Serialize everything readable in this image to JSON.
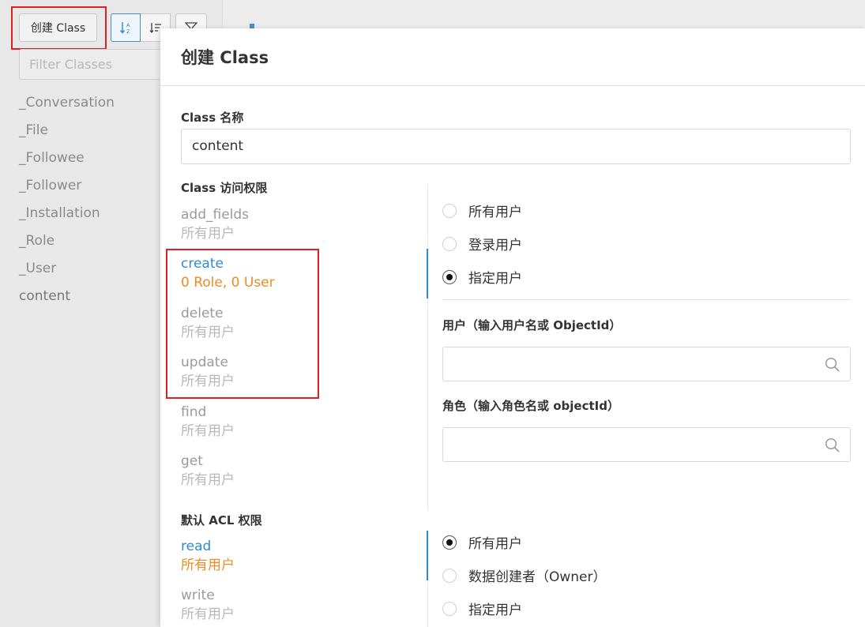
{
  "sidebar": {
    "create_button": "创建 Class",
    "filter_placeholder": "Filter Classes",
    "classes": [
      "_Conversation",
      "_File",
      "_Followee",
      "_Follower",
      "_Installation",
      "_Role",
      "_User",
      "content"
    ]
  },
  "modal": {
    "title": "创建 Class",
    "name_label": "Class 名称",
    "name_value": "content",
    "access_label": "Class 访问权限",
    "permissions": [
      {
        "name": "add_fields",
        "value": "所有用户"
      },
      {
        "name": "create",
        "value": "0 Role, 0 User"
      },
      {
        "name": "delete",
        "value": "所有用户"
      },
      {
        "name": "update",
        "value": "所有用户"
      },
      {
        "name": "find",
        "value": "所有用户"
      },
      {
        "name": "get",
        "value": "所有用户"
      }
    ],
    "access_options": [
      "所有用户",
      "登录用户",
      "指定用户"
    ],
    "user_label": "用户（输入用户名或 ObjectId）",
    "role_label": "角色（输入角色名或 objectId）",
    "acl_label": "默认 ACL 权限",
    "acl_permissions": [
      {
        "name": "read",
        "value": "所有用户"
      },
      {
        "name": "write",
        "value": "所有用户"
      }
    ],
    "acl_options": [
      "所有用户",
      "数据创建者（Owner）",
      "指定用户"
    ]
  },
  "colors": {
    "accent": "#2e8bd0",
    "active_value": "#f08a24",
    "highlight": "#e02020"
  }
}
